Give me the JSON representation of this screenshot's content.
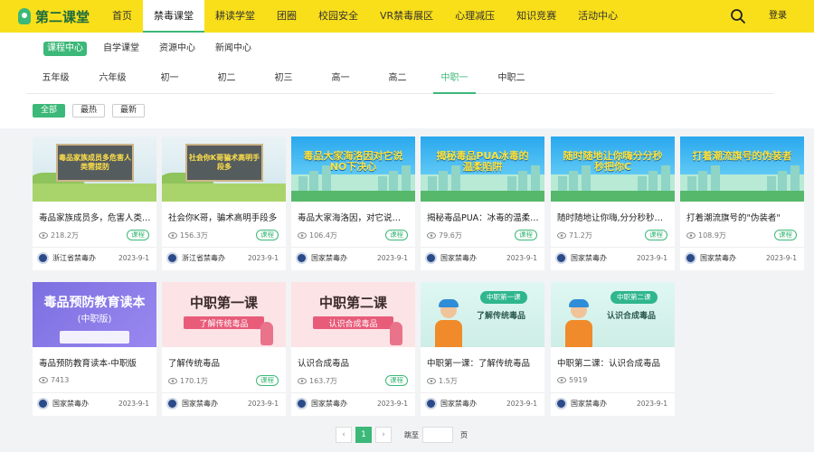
{
  "logo": {
    "text": "第二课堂"
  },
  "nav": [
    "首页",
    "禁毒课堂",
    "耕读学堂",
    "团圈",
    "校园安全",
    "VR禁毒展区",
    "心理减压",
    "知识竞赛",
    "活动中心"
  ],
  "nav_active": 1,
  "header": {
    "login": "登录"
  },
  "sub_tabs": [
    "课程中心",
    "自学课堂",
    "资源中心",
    "新闻中心"
  ],
  "grades": [
    "五年级",
    "六年级",
    "初一",
    "初二",
    "初三",
    "高一",
    "高二",
    "中职一",
    "中职二"
  ],
  "grade_active": 7,
  "filters": [
    "全部",
    "最热",
    "最新"
  ],
  "cards": [
    {
      "title": "毒品家族成员多，危害人类…",
      "views": "218.2万",
      "badge": "课程",
      "publisher": "浙江省禁毒办",
      "date": "2023-9-1",
      "art": "gray",
      "thumb_text": "毒品家族成员多危害人类需提防"
    },
    {
      "title": "社会你K哥，骗术高明手段多",
      "views": "156.3万",
      "badge": "课程",
      "publisher": "浙江省禁毒办",
      "date": "2023-9-1",
      "art": "gray",
      "thumb_text": "社会你K哥骗术高明手段多"
    },
    {
      "title": "毒品大家海洛因，对它说…",
      "views": "106.4万",
      "badge": "课程",
      "publisher": "国家禁毒办",
      "date": "2023-9-1",
      "art": "sky",
      "thumb_text": "毒品大家海洛因对它说NO下决心"
    },
    {
      "title": "揭秘毒品PUA：冰毒的温柔…",
      "views": "79.6万",
      "badge": "课程",
      "publisher": "国家禁毒办",
      "date": "2023-9-1",
      "art": "sky",
      "thumb_text": "揭秘毒品PUA冰毒的温柔陷阱"
    },
    {
      "title": "随时随地让你嗨,分分秒秒…",
      "views": "71.2万",
      "badge": "课程",
      "publisher": "国家禁毒办",
      "date": "2023-9-1",
      "art": "sky",
      "thumb_text": "随时随地让你嗨分分秒秒把你C"
    },
    {
      "title": "打着潮流旗号的\"伪装者\"",
      "views": "108.9万",
      "badge": "课程",
      "publisher": "国家禁毒办",
      "date": "2023-9-1",
      "art": "sky",
      "thumb_text": "打着潮流旗号的伪装者"
    },
    {
      "title": "毒品预防教育读本-中职版",
      "views": "7413",
      "badge": "",
      "publisher": "国家禁毒办",
      "date": "2023-9-1",
      "art": "purple",
      "thumb_text": "毒品预防教育读本",
      "thumb_sub": "(中职版)"
    },
    {
      "title": "了解传统毒品",
      "views": "170.1万",
      "badge": "课程",
      "publisher": "国家禁毒办",
      "date": "2023-9-1",
      "art": "pink",
      "thumb_text": "中职第一课",
      "thumb_sub": "了解传统毒品"
    },
    {
      "title": "认识合成毒品",
      "views": "163.7万",
      "badge": "课程",
      "publisher": "国家禁毒办",
      "date": "2023-9-1",
      "art": "pink",
      "thumb_text": "中职第二课",
      "thumb_sub": "认识合成毒品"
    },
    {
      "title": "中职第一课：了解传统毒品",
      "views": "1.5万",
      "badge": "",
      "publisher": "国家禁毒办",
      "date": "2023-9-1",
      "art": "mint",
      "thumb_text": "中职第一课",
      "thumb_sub": "了解传统毒品"
    },
    {
      "title": "中职第二课：认识合成毒品",
      "views": "5919",
      "badge": "",
      "publisher": "国家禁毒办",
      "date": "2023-9-1",
      "art": "mint",
      "thumb_text": "中职第二课",
      "thumb_sub": "认识合成毒品"
    }
  ],
  "pagination": {
    "prev": "‹",
    "current": "1",
    "next": "›",
    "goto_label": "跳至",
    "unit": "页",
    "input_value": ""
  },
  "colors": {
    "brand_yellow": "#f9df1a",
    "accent_green": "#3cb878"
  },
  "icons": {
    "search": "search-icon",
    "views": "eye-icon",
    "publisher": "police-badge-icon"
  }
}
